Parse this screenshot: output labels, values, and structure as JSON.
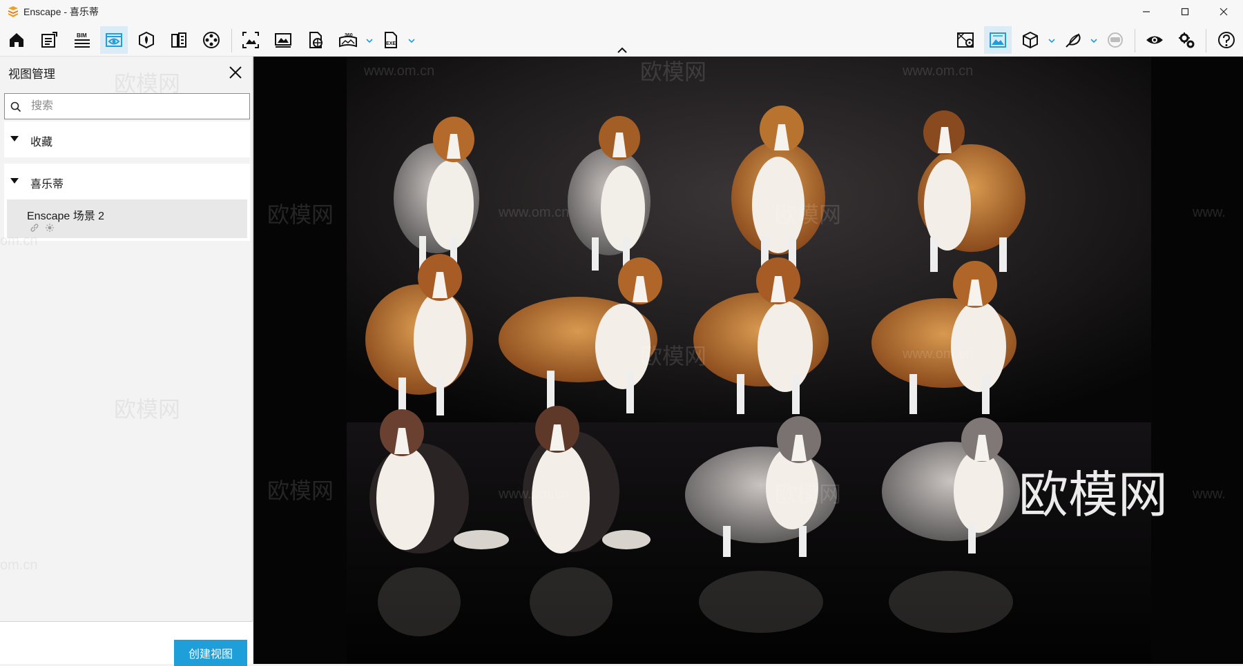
{
  "window": {
    "title": "Enscape - 喜乐蒂",
    "controls": [
      "minimize",
      "maximize",
      "close"
    ]
  },
  "toolbar": {
    "left_icons": [
      "home-icon",
      "notes-icon",
      "bim-icon",
      "view-management-icon",
      "asset-library-icon",
      "material-editor-icon",
      "video-editor-icon",
      "screenshot-icon",
      "batch-render-icon",
      "web-standalone-icon",
      "panorama-360-icon",
      "export-exe-icon"
    ],
    "right_icons": [
      "site-context-icon",
      "render-view-icon",
      "cube-view-icon",
      "feather-icon",
      "vr-headset-icon",
      "visual-settings-icon",
      "general-settings-icon",
      "help-icon"
    ],
    "bim_label": "BIM",
    "pano_label": "360",
    "exe_label": "EXE"
  },
  "panel": {
    "title": "视图管理",
    "search_placeholder": "搜索",
    "groups": [
      {
        "label": "收藏",
        "items": []
      },
      {
        "label": "喜乐蒂",
        "items": [
          {
            "label": "Enscape 场景 2"
          }
        ]
      }
    ],
    "create_button": "创建视图"
  },
  "viewport": {
    "watermark_text": "欧模网",
    "watermark_url": "www.om.cn",
    "watermark_url_fragment": "om.cn",
    "watermark_url_left": "www.",
    "subject": "Shetland sheepdogs, 12 in a 4x3 grid on black background"
  },
  "colors": {
    "accent": "#1e9fd9",
    "active_tool_bg": "#dcecf6",
    "viewport_bg": "#0a0a0a"
  }
}
